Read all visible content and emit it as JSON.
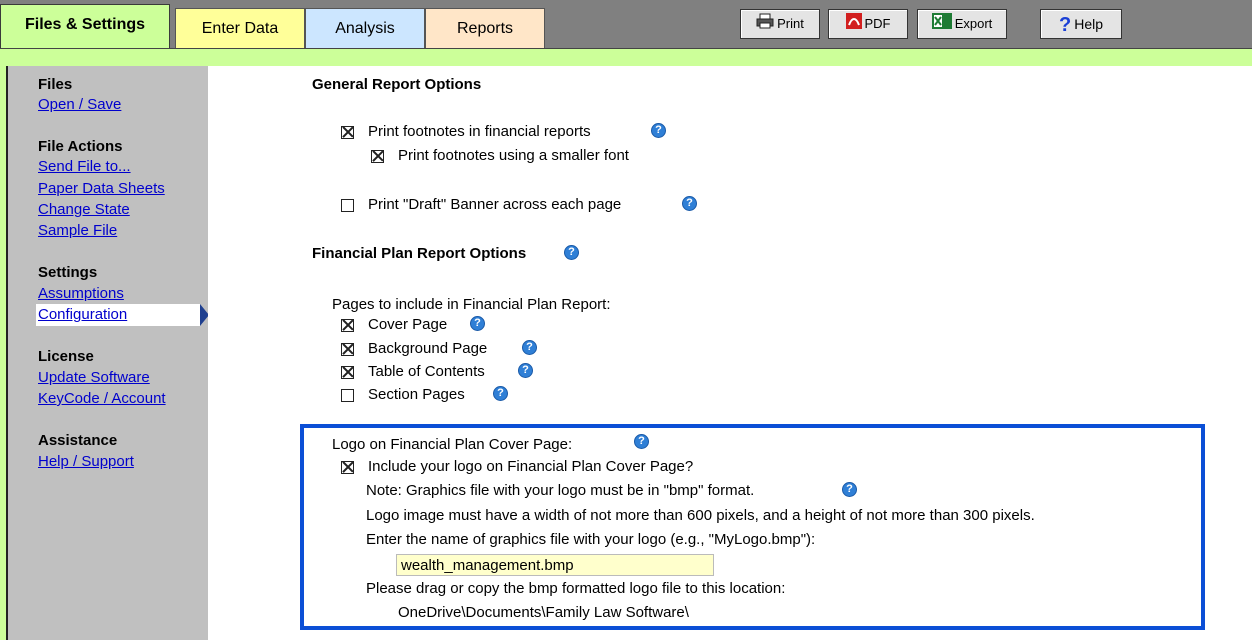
{
  "tabs": {
    "files_settings": "Files & Settings",
    "enter_data": "Enter Data",
    "analysis": "Analysis",
    "reports": "Reports"
  },
  "toolbar": {
    "print": "Print",
    "pdf": "PDF",
    "export": "Export",
    "help": "Help"
  },
  "sidebar": {
    "files_head": "Files",
    "open_save": "Open / Save",
    "file_actions_head": "File Actions",
    "send_file": "Send File to...",
    "paper_data": "Paper Data Sheets",
    "change_state": "Change State",
    "sample_file": "Sample File",
    "settings_head": "Settings",
    "assumptions": "Assumptions",
    "configuration": "Configuration",
    "license_head": "License",
    "update_software": "Update Software",
    "keycode": "KeyCode / Account",
    "assistance_head": "Assistance",
    "help_support": "Help / Support"
  },
  "general": {
    "title": "General Report Options",
    "print_footnotes": "Print footnotes in financial reports",
    "print_footnotes_checked": true,
    "smaller_font": "Print footnotes using a smaller font",
    "smaller_font_checked": true,
    "draft_banner": "Print \"Draft\" Banner across each page",
    "draft_banner_checked": false
  },
  "financial": {
    "title": "Financial Plan Report Options",
    "pages_label": "Pages to include in Financial Plan Report:",
    "cover_page": "Cover Page",
    "background_page": "Background Page",
    "table_of_contents": "Table of Contents",
    "section_pages": "Section Pages"
  },
  "logo": {
    "title": "Logo on Financial Plan Cover Page:",
    "include": "Include your logo on Financial Plan Cover Page?",
    "note": "Note: Graphics file with your logo must be in \"bmp\" format.",
    "size_rule": "Logo image must have a width of not more than 600 pixels, and a height of not more than 300 pixels.",
    "enter_name": "Enter the name of graphics file with your logo (e.g., \"MyLogo.bmp\"):",
    "filename": "wealth_management.bmp",
    "drag_copy": "Please drag or copy the bmp formatted logo file to this location:",
    "location": "OneDrive\\Documents\\Family Law Software\\"
  },
  "colors": {
    "green_tab": "#ccff99",
    "highlight_border": "#0b4fd6",
    "link": "#0000cc",
    "help_icon": "#2f7fd6"
  },
  "icons": [
    "printer-icon",
    "pdf-icon",
    "excel-icon",
    "help-question-icon",
    "info-help-icon"
  ]
}
